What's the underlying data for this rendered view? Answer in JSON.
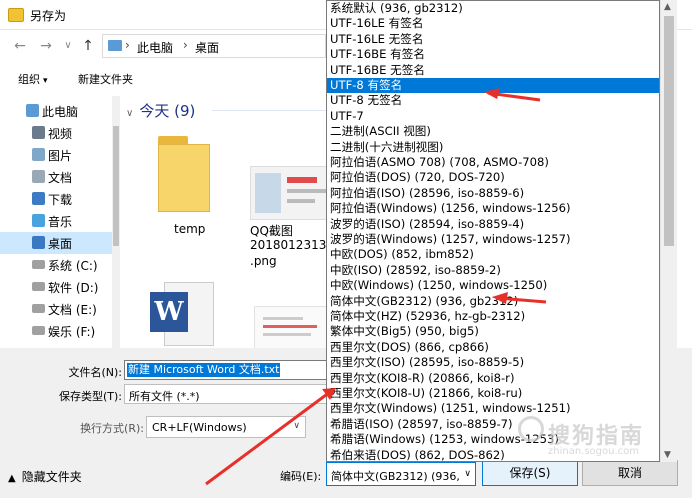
{
  "window": {
    "title": "另存为"
  },
  "nav": {
    "back": "←",
    "forward": "→",
    "recent": "∨",
    "up": "↑",
    "breadcrumb": [
      "此电脑",
      "桌面"
    ]
  },
  "toolbar": {
    "organize": "组织",
    "new_folder": "新建文件夹"
  },
  "sidebar": {
    "items": [
      {
        "label": "此电脑",
        "icon": "computer-icon"
      },
      {
        "label": "视频",
        "icon": "video-folder-icon"
      },
      {
        "label": "图片",
        "icon": "pictures-folder-icon"
      },
      {
        "label": "文档",
        "icon": "documents-folder-icon"
      },
      {
        "label": "下载",
        "icon": "download-folder-icon"
      },
      {
        "label": "音乐",
        "icon": "music-folder-icon"
      },
      {
        "label": "桌面",
        "icon": "desktop-folder-icon"
      },
      {
        "label": "系统 (C:)",
        "icon": "drive-icon"
      },
      {
        "label": "软件 (D:)",
        "icon": "drive-icon"
      },
      {
        "label": "文档 (E:)",
        "icon": "drive-icon"
      },
      {
        "label": "娱乐 (F:)",
        "icon": "drive-icon"
      }
    ],
    "selected_index": 6
  },
  "main": {
    "group_header": "今天 (9)",
    "files": [
      {
        "name": "temp",
        "icon": "folder-icon"
      },
      {
        "name_lines": [
          "QQ截图",
          "2018012313317",
          ".png"
        ],
        "icon": "image-thumbnail"
      },
      {
        "name": "",
        "icon": "word-document-icon"
      },
      {
        "name": "",
        "icon": "document-thumbnail"
      }
    ]
  },
  "form": {
    "filename_label": "文件名(N):",
    "filename_value": "新建 Microsoft Word 文档.txt",
    "type_label": "保存类型(T):",
    "type_value": "所有文件 (*.*)",
    "newline_label": "换行方式(R):",
    "newline_value": "CR+LF(Windows)",
    "hide_folders": "隐藏文件夹",
    "encoding_label": "编码(E):",
    "encoding_value": "简体中文(GB2312) (936,",
    "save_button": "保存(S)",
    "cancel_button": "取消"
  },
  "encoding_options": [
    "系统默认 (936, gb2312)",
    "UTF-16LE 有签名",
    "UTF-16LE 无签名",
    "UTF-16BE 有签名",
    "UTF-16BE 无签名",
    "UTF-8 有签名",
    "UTF-8 无签名",
    "UTF-7",
    "二进制(ASCII 视图)",
    "二进制(十六进制视图)",
    "阿拉伯语(ASMO 708) (708, ASMO-708)",
    "阿拉伯语(DOS) (720, DOS-720)",
    "阿拉伯语(ISO) (28596, iso-8859-6)",
    "阿拉伯语(Windows) (1256, windows-1256)",
    "波罗的语(ISO) (28594, iso-8859-4)",
    "波罗的语(Windows) (1257, windows-1257)",
    "中欧(DOS) (852, ibm852)",
    "中欧(ISO) (28592, iso-8859-2)",
    "中欧(Windows) (1250, windows-1250)",
    "简体中文(GB2312) (936, gb2312)",
    "简体中文(HZ) (52936, hz-gb-2312)",
    "繁体中文(Big5) (950, big5)",
    "西里尔文(DOS) (866, cp866)",
    "西里尔文(ISO) (28595, iso-8859-5)",
    "西里尔文(KOI8-R) (20866, koi8-r)",
    "西里尔文(KOI8-U) (21866, koi8-ru)",
    "西里尔文(Windows) (1251, windows-1251)",
    "希腊语(ISO) (28597, iso-8859-7)",
    "希腊语(Windows) (1253, windows-1253)",
    "希伯来语(DOS) (862, DOS-862)"
  ],
  "encoding_selected_index": 5,
  "watermark": {
    "text": "搜狗指南",
    "url": "zhinan.sogou.com"
  },
  "colors": {
    "selection": "#0078d7",
    "arrow": "#e8302a",
    "sidebar_selected": "#cce8ff"
  }
}
